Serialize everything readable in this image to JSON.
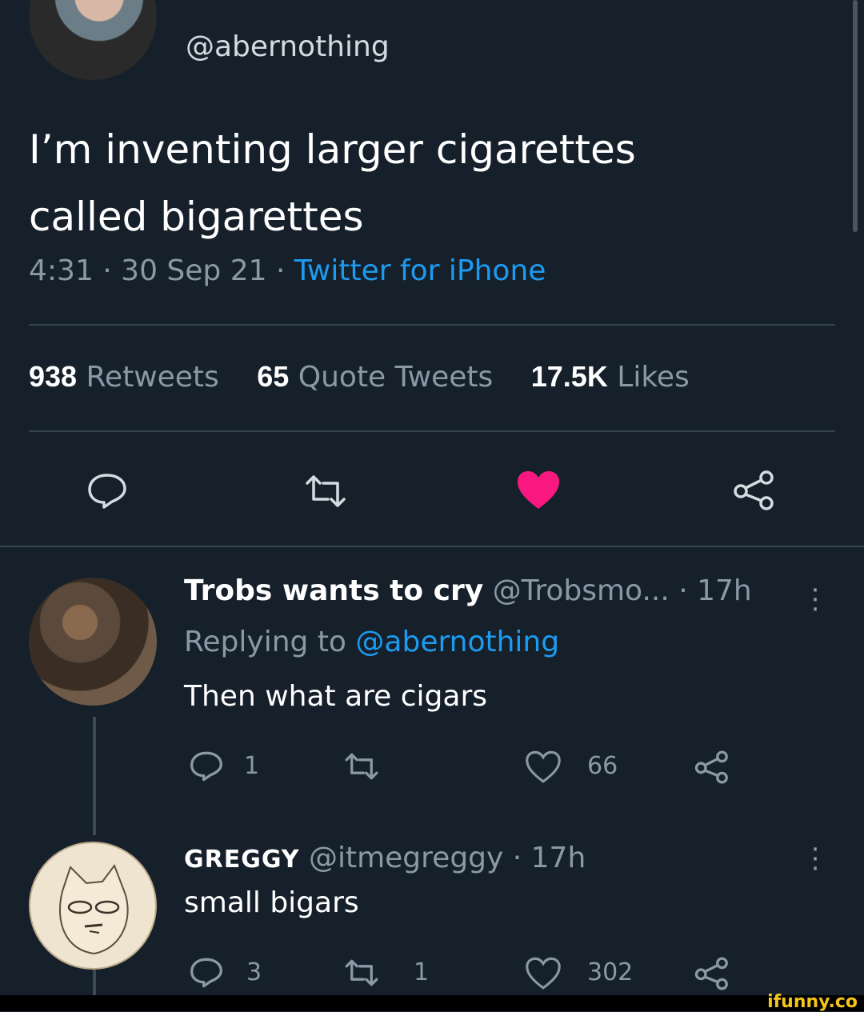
{
  "tweet": {
    "handle": "@abernothing",
    "text_line1": "I’m inventing larger cigarettes",
    "text_line2": "called bigarettes",
    "time": "4:31 · 30 Sep 21 · ",
    "source": "Twitter for iPhone",
    "stats": {
      "retweets_count": "938",
      "retweets_label": "Retweets",
      "quotes_count": "65",
      "quotes_label": "Quote Tweets",
      "likes_count": "17.5K",
      "likes_label": "Likes"
    },
    "liked": true
  },
  "replies": [
    {
      "name": "Trobs wants to cry",
      "handle_time": " @Trobsmo... · 17h",
      "replying_prefix": "Replying to ",
      "replying_handle": "@abernothing",
      "text": "Then what are cigars",
      "reply_count": "1",
      "retweet_count": "",
      "like_count": "66"
    },
    {
      "name": "GREGGY",
      "handle_time": " @itmegreggy · 17h",
      "text": "small bigars",
      "reply_count": "3",
      "retweet_count": "1",
      "like_count": "302"
    }
  ],
  "watermark": "ifunny.co",
  "colors": {
    "background": "#15202b",
    "accent": "#1d9bf0",
    "like": "#f91880",
    "muted": "#8b98a5"
  }
}
